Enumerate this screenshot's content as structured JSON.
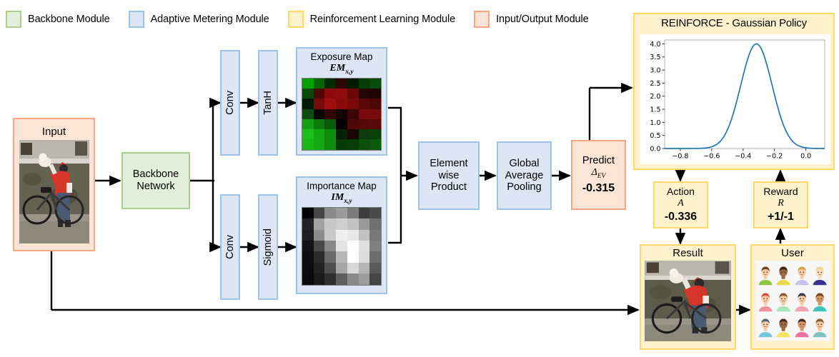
{
  "legend": {
    "items": [
      {
        "label": "Backbone Module",
        "fill": "#e2efda",
        "border": "#a9d08e"
      },
      {
        "label": "Adaptive Metering Module",
        "fill": "#dce6f4",
        "border": "#9dc3e6"
      },
      {
        "label": "Reinforcement Learning Module",
        "fill": "#fdf2cc",
        "border": "#ffd966"
      },
      {
        "label": "Input/Output Module",
        "fill": "#fce4d6",
        "border": "#f4a582"
      }
    ]
  },
  "nodes": {
    "input": {
      "title": "Input"
    },
    "backbone": {
      "line1": "Backbone",
      "line2": "Network"
    },
    "conv_top": {
      "label": "Conv"
    },
    "tanh": {
      "label": "TanH"
    },
    "conv_bottom": {
      "label": "Conv"
    },
    "sigmoid": {
      "label": "Sigmoid"
    },
    "exposure_map": {
      "title": "Exposure Map",
      "symbol": "EM",
      "subscript": "x,y"
    },
    "importance_map": {
      "title": "Importance Map",
      "symbol": "IM",
      "subscript": "x,y"
    },
    "elementwise": {
      "line1": "Element",
      "line2": "wise",
      "line3": "Product"
    },
    "pooling": {
      "line1": "Global",
      "line2": "Average",
      "line3": "Pooling"
    },
    "predict": {
      "title": "Predict",
      "symbol": "Δ",
      "subscript": "EV",
      "value": "-0.315"
    },
    "action": {
      "title": "Action",
      "symbol": "A",
      "value": "-0.336"
    },
    "reward": {
      "title": "Reward",
      "symbol": "R",
      "value": "+1/-1"
    },
    "result": {
      "title": "Result"
    },
    "user": {
      "title": "User"
    }
  },
  "chart_data": {
    "type": "line",
    "title": "REINFORCE - Gaussian Policy",
    "xlabel": "",
    "ylabel": "",
    "xlim": [
      -0.9,
      0.12
    ],
    "ylim": [
      0.0,
      4.15
    ],
    "xticks": [
      -0.8,
      -0.6,
      -0.4,
      -0.2,
      0.0
    ],
    "xtick_labels": [
      "−0.8",
      "−0.6",
      "−0.4",
      "−0.2",
      "0.0"
    ],
    "yticks": [
      0.0,
      0.5,
      1.0,
      1.5,
      2.0,
      2.5,
      3.0,
      3.5,
      4.0
    ],
    "ytick_labels": [
      "0.0",
      "0.5",
      "1.0",
      "1.5",
      "2.0",
      "2.5",
      "3.0",
      "3.5",
      "4.0"
    ],
    "grid": false,
    "legend": "none",
    "line_color": "#1f77b4",
    "distribution": {
      "name": "gaussian",
      "mean": -0.315,
      "sigma": 0.0997,
      "peak": 4.0
    },
    "x": [
      -0.9,
      -0.85,
      -0.8,
      -0.75,
      -0.7,
      -0.65,
      -0.6,
      -0.55,
      -0.5,
      -0.45,
      -0.4,
      -0.35,
      -0.315,
      -0.3,
      -0.25,
      -0.2,
      -0.15,
      -0.1,
      -0.05,
      0.0,
      0.05,
      0.1
    ],
    "y": [
      0.0,
      0.0,
      0.0,
      0.01,
      0.04,
      0.14,
      0.4,
      0.99,
      2.02,
      3.2,
      3.86,
      3.92,
      4.0,
      3.96,
      3.09,
      2.0,
      1.0,
      0.4,
      0.13,
      0.03,
      0.01,
      0.0
    ]
  },
  "maps": {
    "exposure": {
      "rows": 7,
      "cols": 7,
      "cells": [
        [
          "#00a000",
          "#046404",
          "#012a01",
          "#2a0606",
          "#011a01",
          "#053d05",
          "#0a4a0a"
        ],
        [
          "#084808",
          "#4a0808",
          "#8c0a0a",
          "#900c0c",
          "#6a0808",
          "#260505",
          "#200404"
        ],
        [
          "#021802",
          "#780a0a",
          "#a00d0d",
          "#8a0a0a",
          "#7d0a0a",
          "#5a0808",
          "#4c0707"
        ],
        [
          "#0d4a0d",
          "#050505",
          "#320606",
          "#150303",
          "#3a0707",
          "#760a0a",
          "#780a0a"
        ],
        [
          "#12a012",
          "#0d7a0d",
          "#085a08",
          "#060202",
          "#4e0808",
          "#540808",
          "#5a0909"
        ],
        [
          "#1cc01c",
          "#12a812",
          "#0e8c0e",
          "#062006",
          "#1a0404",
          "#0c3a0c",
          "#094209"
        ],
        [
          "#18b818",
          "#14a814",
          "#0e8a0e",
          "#063a06",
          "#073e07",
          "#0a500a",
          "#0d5a0d"
        ]
      ]
    },
    "importance": {
      "rows": 7,
      "cols": 7,
      "cells": [
        [
          "#050505",
          "#464646",
          "#8a8a8a",
          "#9a9a9a",
          "#7a7a7a",
          "#3c3c3c",
          "#4a4a4a"
        ],
        [
          "#232323",
          "#a2a2a2",
          "#c8c8c8",
          "#cfcfcf",
          "#c2c2c2",
          "#9a9a9a",
          "#707070"
        ],
        [
          "#1e1e1e",
          "#8c8c8c",
          "#cacaca",
          "#efefef",
          "#e8e8e8",
          "#c2c2c2",
          "#787878"
        ],
        [
          "#141414",
          "#484848",
          "#888888",
          "#e4e4e4",
          "#fbfbfb",
          "#e0e0e0",
          "#808080"
        ],
        [
          "#0e0e0e",
          "#2a2a2a",
          "#6a6a6a",
          "#b8b8b8",
          "#ffffff",
          "#dcdcdc",
          "#6e6e6e"
        ],
        [
          "#0c0c0c",
          "#222222",
          "#4e4e4e",
          "#a6a6a6",
          "#d8d8d8",
          "#b4b4b4",
          "#5a5a5a"
        ],
        [
          "#0a0a0a",
          "#1a1a1a",
          "#2e2e2e",
          "#5e5e5e",
          "#8a8a8a",
          "#9c9c9c",
          "#454545"
        ]
      ]
    }
  },
  "avatars": {
    "rows": 3,
    "cols": 4,
    "people": [
      {
        "skin": "#f6cda8",
        "hair": "#6b4226",
        "shirt": "#8cc63f"
      },
      {
        "skin": "#9c6640",
        "hair": "#3a2418",
        "shirt": "#e8d84a"
      },
      {
        "skin": "#f6cda8",
        "hair": "#d9a441",
        "shirt": "#c7c2f0"
      },
      {
        "skin": "#f9ddbd",
        "hair": "#f2d98a",
        "shirt": "#3b2f8f"
      },
      {
        "skin": "#f6cda8",
        "hair": "#e04a3a",
        "shirt": "#f08fa0"
      },
      {
        "skin": "#f3c9a0",
        "hair": "#8a5a33",
        "shirt": "#a5e8b8"
      },
      {
        "skin": "#f6cda8",
        "hair": "#3a3550",
        "shirt": "#f4a3b0"
      },
      {
        "skin": "#d49a6a",
        "hair": "#7a4a28",
        "shirt": "#3ec4bb"
      },
      {
        "skin": "#f6cda8",
        "hair": "#5a5f7a",
        "shirt": "#7ac8e0"
      },
      {
        "skin": "#9c6640",
        "hair": "#4a2d18",
        "shirt": "#f2e45c"
      },
      {
        "skin": "#d49a6a",
        "hair": "#4a2d18",
        "shirt": "#f06fa0"
      },
      {
        "skin": "#f3c9a0",
        "hair": "#8a5a33",
        "shirt": "#7ec4c0"
      }
    ]
  }
}
